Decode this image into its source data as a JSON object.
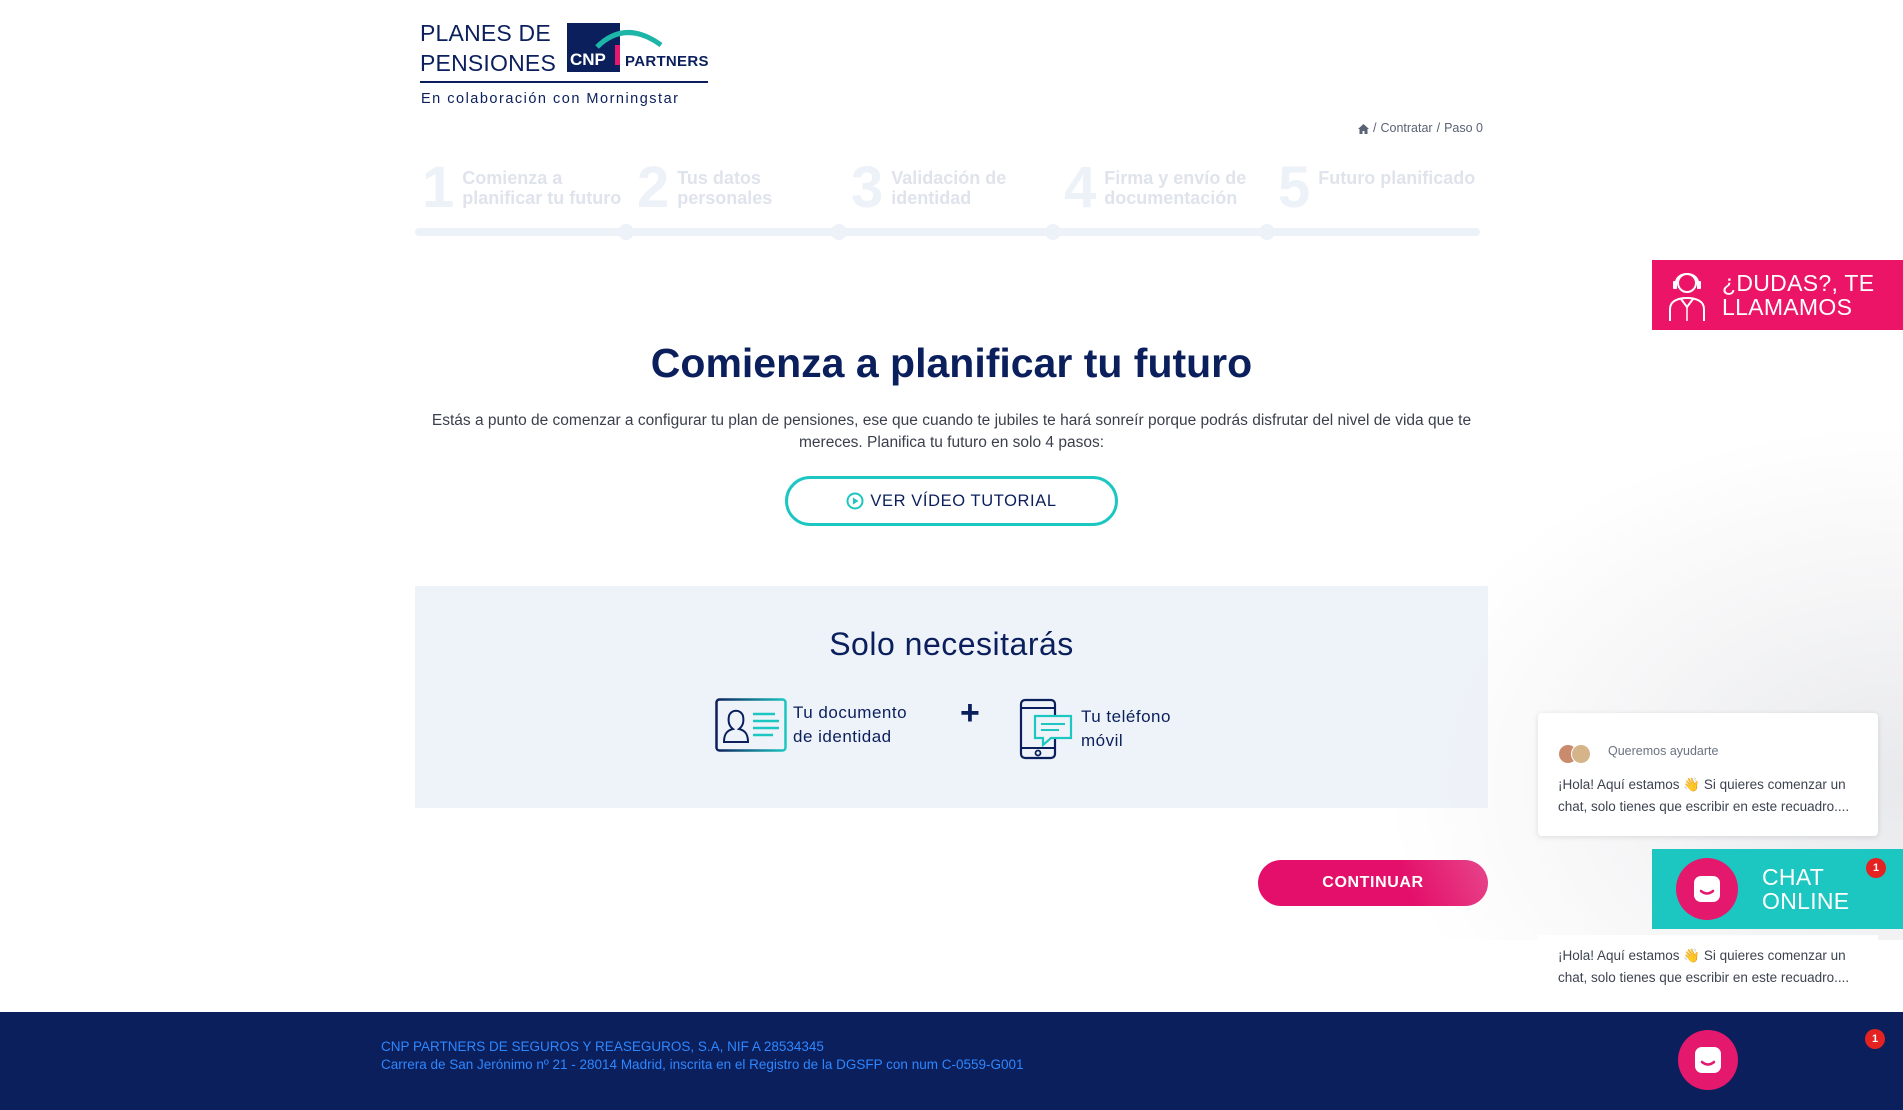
{
  "logo": {
    "line1": "PLANES DE",
    "line2": "PENSIONES",
    "cnp": "CNP",
    "partners": "PARTNERS",
    "subtitle": "En colaboración con Morningstar"
  },
  "breadcrumb": {
    "separator": "/",
    "items": [
      "Contratar",
      "Paso 0"
    ]
  },
  "stepper": {
    "steps": [
      {
        "number": "1",
        "label": "Comienza a planificar tu futuro"
      },
      {
        "number": "2",
        "label": "Tus datos personales"
      },
      {
        "number": "3",
        "label": "Validación de identidad"
      },
      {
        "number": "4",
        "label": "Firma y envío de documentación"
      },
      {
        "number": "5",
        "label": "Futuro planificado"
      }
    ]
  },
  "main": {
    "title": "Comienza a planificar tu futuro",
    "intro": "Estás a punto de comenzar a configurar tu plan de pensiones, ese que cuando te jubiles te hará sonreír porque podrás disfrutar del nivel de vida que te mereces. Planifica tu futuro en solo 4 pasos:",
    "video_button": "VER VÍDEO TUTORIAL"
  },
  "needs": {
    "title": "Solo necesitarás",
    "item1_line1": "Tu documento",
    "item1_line2": "de identidad",
    "plus": "+",
    "item2_line1": "Tu teléfono",
    "item2_line2": "móvil"
  },
  "continue_button": "CONTINUAR",
  "callback": {
    "line1": "¿DUDAS?, TE",
    "line2": "LLAMAMOS"
  },
  "chat": {
    "header": "Queremos ayudarte",
    "message": "¡Hola! Aquí estamos 👋 Si quieres comenzar un chat, solo tienes que escribir en este recuadro....",
    "online_line1": "CHAT",
    "online_line2": "ONLINE",
    "badge": "1"
  },
  "footer": {
    "line1": "CNP PARTNERS DE SEGUROS Y REASEGUROS, S.A, NIF A 28534345",
    "line2": "Carrera de San Jerónimo nº 21 - 28014 Madrid, inscrita en el Registro de la DGSFP con num C-0559-G001"
  },
  "colors": {
    "navy": "#0b1f5c",
    "pink": "#e40f6a",
    "teal": "#1cc7c1",
    "panel": "#eef3fa"
  }
}
